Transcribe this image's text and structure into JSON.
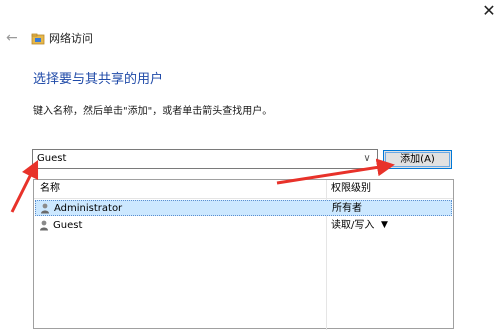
{
  "window": {
    "close_glyph": "✕",
    "back_glyph": "←",
    "title_icon": "network-folder-icon",
    "title": "网络访问"
  },
  "main": {
    "heading": "选择要与其共享的用户",
    "instruction": "键入名称，然后单击\"添加\"，或者单击箭头查找用户。",
    "combo_value": "Guest",
    "combo_drop_glyph": "∨",
    "add_button": "添加(A)"
  },
  "list": {
    "headers": {
      "name": "名称",
      "permission": "权限级别"
    },
    "rows": [
      {
        "name": "Administrator",
        "permission": "所有者",
        "selected": true,
        "has_dropdown": false
      },
      {
        "name": "Guest",
        "permission": "读取/写入",
        "selected": false,
        "has_dropdown": true,
        "dropdown_glyph": "▼"
      }
    ]
  },
  "colors": {
    "heading": "#1f4aa8",
    "selection": "#cce8ff",
    "annotation_arrow": "#e8322a",
    "button_focus": "#0078d7"
  }
}
